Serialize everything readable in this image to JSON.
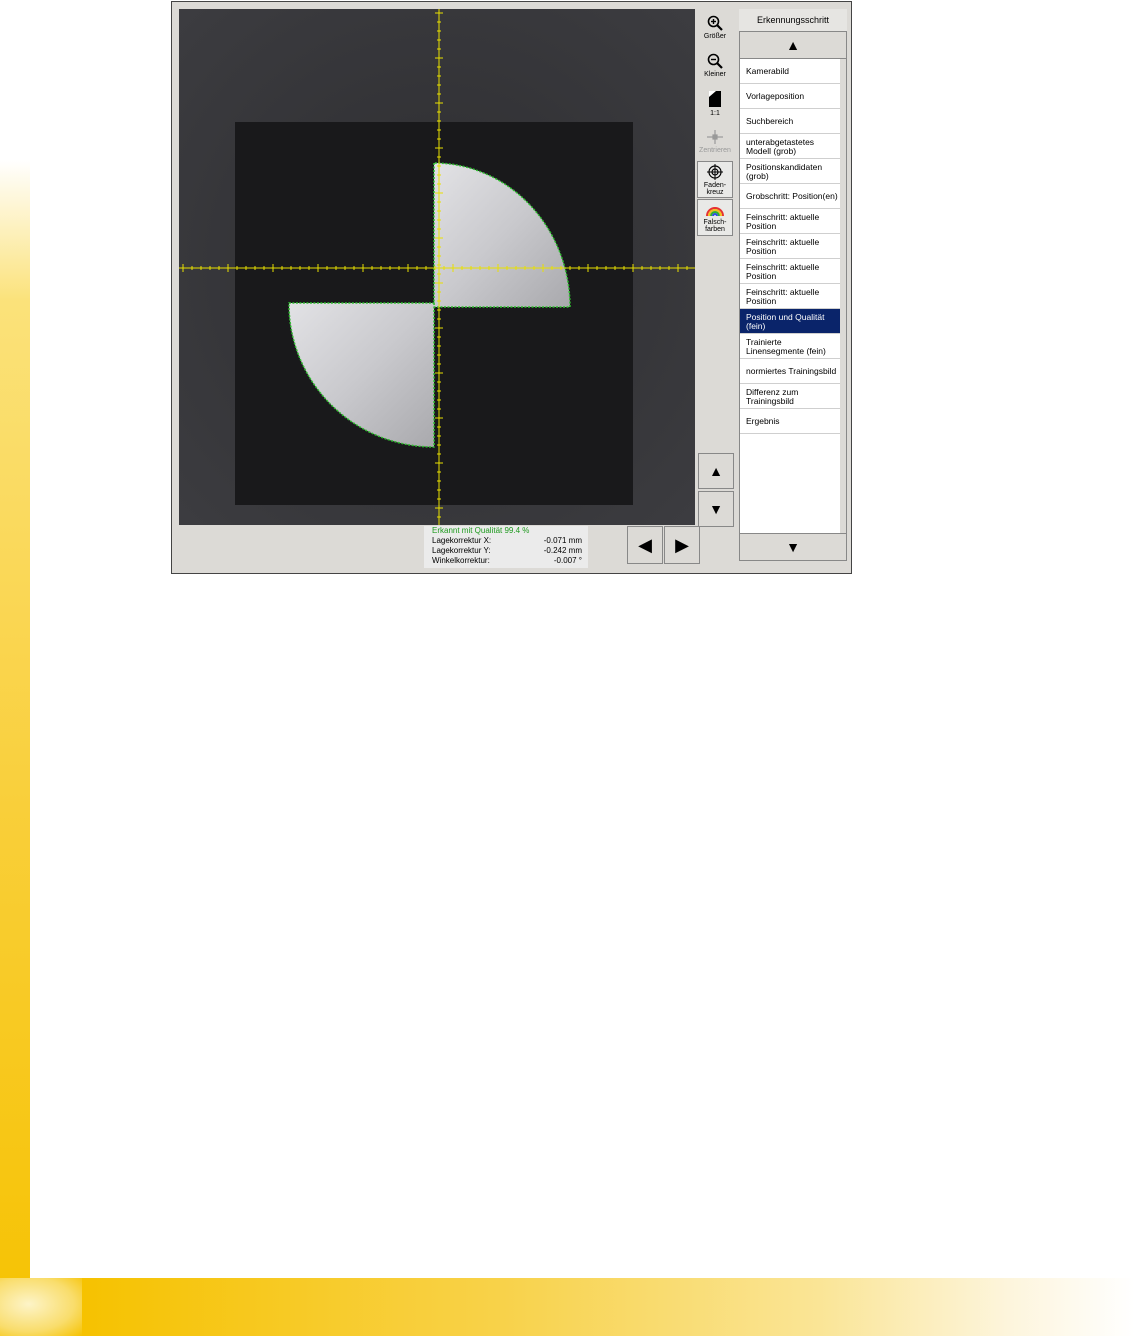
{
  "tools": {
    "zoom_in": {
      "label": "Größer",
      "icon": "zoom-in-icon"
    },
    "zoom_out": {
      "label": "Kleiner",
      "icon": "zoom-out-icon"
    },
    "one_to_one": {
      "label": "1:1",
      "icon": "one-to-one-icon"
    },
    "center": {
      "label": "Zentrieren",
      "icon": "center-icon"
    },
    "crosshair": {
      "label": "Faden-\nkreuz",
      "icon": "crosshair-icon"
    },
    "false_color": {
      "label": "Falsch-\nfarben",
      "icon": "rainbow-icon"
    },
    "scroll_up": "▲",
    "scroll_down": "▼"
  },
  "steps": {
    "title": "Erkennungsschritt",
    "items": [
      "Kamerabild",
      "Vorlageposition",
      "Suchbereich",
      "unterabgetastetes Modell (grob)",
      "Positionskandidaten (grob)",
      "Grobschritt: Position(en)",
      "Feinschritt: aktuelle Position",
      "Feinschritt: aktuelle Position",
      "Feinschritt: aktuelle Position",
      "Feinschritt: aktuelle Position",
      "Position und Qualität (fein)",
      "Trainierte Linensegmente (fein)",
      "normiertes Trainingsbild",
      "Differenz zum Trainingsbild",
      "Ergebnis"
    ],
    "selected_index": 10
  },
  "result": {
    "quality": "Erkannt mit Qualität  99.4 %",
    "x_label": "Lagekorrektur X:",
    "x_value": "-0.071 mm",
    "y_label": "Lagekorrektur Y:",
    "y_value": "-0.242 mm",
    "angle_label": "Winkelkorrektur:",
    "angle_value": "-0.007 °"
  },
  "colors": {
    "selected_bg": "#0a246a",
    "crosshair": "#e8e000",
    "contour": "#2fbf2f",
    "quality_text": "#1f9a1f"
  }
}
